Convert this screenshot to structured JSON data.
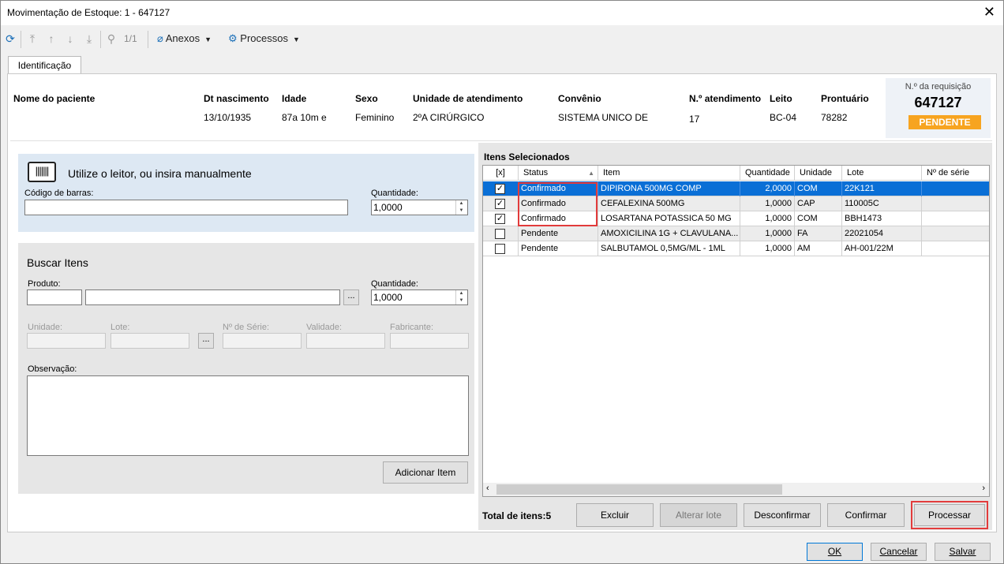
{
  "window": {
    "title": "Movimentação de Estoque: 1 - 647127"
  },
  "toolbar": {
    "nav_counter": "1/1",
    "anexos": "Anexos",
    "processos": "Processos"
  },
  "tabs": [
    {
      "label": "Identificação"
    }
  ],
  "patient": {
    "labels": {
      "nome": "Nome do paciente",
      "dt_nascimento": "Dt nascimento",
      "idade": "Idade",
      "sexo": "Sexo",
      "unidade": "Unidade de atendimento",
      "convenio": "Convênio",
      "atendimento": "N.º atendimento",
      "leito": "Leito",
      "prontuario": "Prontuário"
    },
    "values": {
      "dt_nascimento": "13/10/1935",
      "idade": "87a 10m  e",
      "sexo": "Feminino",
      "unidade": "2ºA CIRÚRGICO",
      "convenio": "SISTEMA UNICO DE",
      "atendimento": "17",
      "leito": "BC-04",
      "prontuario": "78282"
    }
  },
  "requisicao": {
    "label": "N.º da requisição",
    "number": "647127",
    "status": "PENDENTE",
    "status_color": "#f7a420"
  },
  "leitor": {
    "title": "Utilize o leitor, ou insira manualmente",
    "codigo_label": "Código de barras:",
    "codigo_value": "",
    "quantidade_label": "Quantidade:",
    "quantidade_value": "1,0000"
  },
  "buscar": {
    "title": "Buscar Itens",
    "produto_label": "Produto:",
    "quantidade_label": "Quantidade:",
    "quantidade_value": "1,0000",
    "unidade_label": "Unidade:",
    "lote_label": "Lote:",
    "serie_label": "Nº de Série:",
    "validade_label": "Validade:",
    "fabricante_label": "Fabricante:",
    "observacao_label": "Observação:",
    "add_button": "Adicionar Item",
    "ellipsis": "..."
  },
  "itens": {
    "title": "Itens Selecionados",
    "columns": [
      "[x]",
      "Status",
      "Item",
      "Quantidade",
      "Unidade",
      "Lote",
      "Nº de série"
    ],
    "rows": [
      {
        "checked": true,
        "status": "Confirmado",
        "item": "DIPIRONA 500MG COMP",
        "quantidade": "2,0000",
        "unidade": "COM",
        "lote": "22K121",
        "serie": ""
      },
      {
        "checked": true,
        "status": "Confirmado",
        "item": "CEFALEXINA 500MG",
        "quantidade": "1,0000",
        "unidade": "CAP",
        "lote": "110005C",
        "serie": ""
      },
      {
        "checked": true,
        "status": "Confirmado",
        "item": "LOSARTANA POTASSICA 50 MG",
        "quantidade": "1,0000",
        "unidade": "COM",
        "lote": "BBH1473",
        "serie": ""
      },
      {
        "checked": false,
        "status": "Pendente",
        "item": "AMOXICILINA 1G + CLAVULANA...",
        "quantidade": "1,0000",
        "unidade": "FA",
        "lote": "22021054",
        "serie": ""
      },
      {
        "checked": false,
        "status": "Pendente",
        "item": "SALBUTAMOL 0,5MG/ML - 1ML",
        "quantidade": "1,0000",
        "unidade": "AM",
        "lote": "AH-001/22M",
        "serie": ""
      }
    ],
    "total": "Total de itens:5"
  },
  "actions": {
    "excluir": "Excluir",
    "alterar_lote": "Alterar lote",
    "desconfirmar": "Desconfirmar",
    "confirmar": "Confirmar",
    "processar": "Processar"
  },
  "footer": {
    "ok": "OK",
    "cancelar": "Cancelar",
    "salvar": "Salvar"
  },
  "colors": {
    "selection": "#0a6fd6",
    "highlight": "#e23b3b",
    "panel_blue": "#dde8f3"
  }
}
